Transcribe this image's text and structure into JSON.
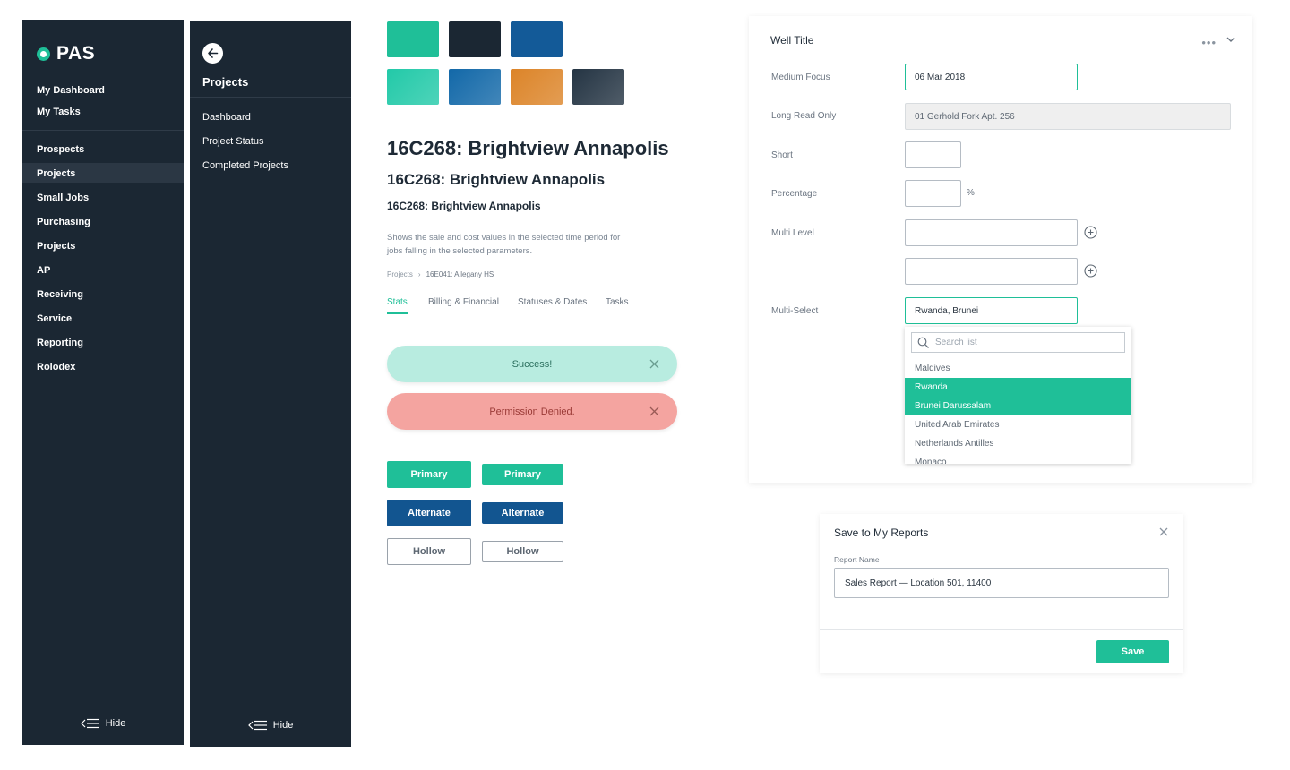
{
  "sidebar_main": {
    "logo_text": "PAS",
    "top_items": [
      "My Dashboard",
      "My Tasks"
    ],
    "items": [
      "Prospects",
      "Projects",
      "Small Jobs",
      "Purchasing",
      "Projects",
      "AP",
      "Receiving",
      "Service",
      "Reporting",
      "Rolodex"
    ],
    "active_item": "Projects",
    "hide_label": "Hide"
  },
  "sidebar_sub": {
    "title": "Projects",
    "items": [
      "Dashboard",
      "Project Status",
      "Completed Projects"
    ],
    "hide_label": "Hide"
  },
  "palette": {
    "row1": [
      "#1fbf98",
      "#1b2733",
      "#135a98"
    ],
    "row2": [
      "#22c9a8",
      "#1268a8",
      "#dc8428",
      "#243443"
    ]
  },
  "typography": {
    "h1": "16C268: Brightview Annapolis",
    "h2": "16C268: Brightview Annapolis",
    "h3": "16C268: Brightview Annapolis",
    "description": "Shows the sale and cost values in the selected time period for jobs falling in the selected parameters."
  },
  "breadcrumb": {
    "root": "Projects",
    "sep": "›",
    "current": "16E041: Allegany HS"
  },
  "tabs": [
    "Stats",
    "Billing & Financial",
    "Statuses & Dates",
    "Tasks"
  ],
  "alerts": {
    "success": "Success!",
    "danger": "Permission Denied."
  },
  "buttons": {
    "primary": "Primary",
    "alternate": "Alternate",
    "hollow": "Hollow"
  },
  "form_card": {
    "title": "Well Title",
    "fields": {
      "medium_focus": {
        "label": "Medium Focus",
        "value": "06 Mar 2018"
      },
      "long_read_only": {
        "label": "Long Read Only",
        "value": "01 Gerhold Fork Apt. 256"
      },
      "short": {
        "label": "Short",
        "value": ""
      },
      "percentage": {
        "label": "Percentage",
        "value": "",
        "suffix": "%"
      },
      "multi_level": {
        "label": "Multi Level",
        "value": ""
      },
      "multi_select": {
        "label": "Multi-Select",
        "value": "Rwanda, Brunei"
      }
    },
    "dropdown": {
      "search_placeholder": "Search list",
      "options": [
        "Maldives",
        "Rwanda",
        "Brunei Darussalam",
        "United Arab Emirates",
        "Netherlands Antilles",
        "Monaco"
      ],
      "selected": [
        "Rwanda",
        "Brunei Darussalam"
      ]
    }
  },
  "modal": {
    "title": "Save to My Reports",
    "label": "Report Name",
    "value": "Sales Report — Location 501, 11400",
    "save_label": "Save"
  },
  "colors": {
    "accent": "#1fbf98",
    "navy": "#1b2733",
    "blue": "#125590",
    "danger": "#f4a4a0",
    "success": "#b8ece0"
  }
}
